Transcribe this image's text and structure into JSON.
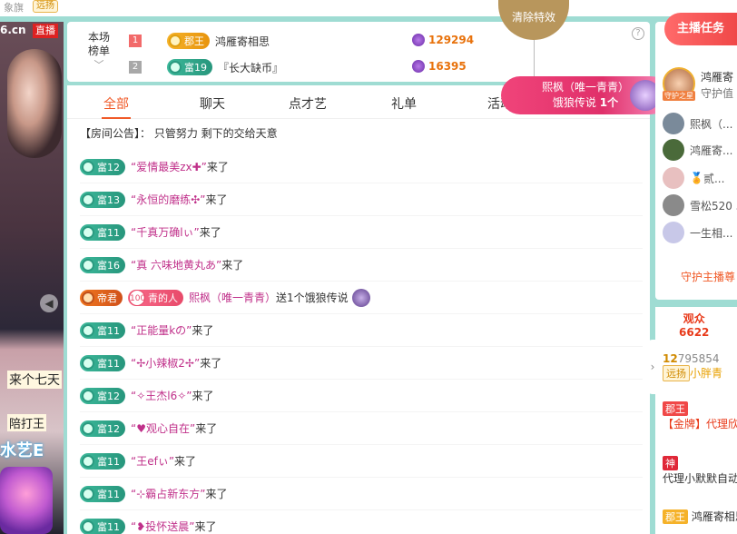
{
  "top_strip": {
    "left_text": "象旗",
    "badge": "远扬"
  },
  "video": {
    "site_text": "6.cn",
    "live_label": "直播",
    "caption1": "来个七天",
    "caption2": "陪打王",
    "banner": "水艺E"
  },
  "ranking": {
    "title": "本场榜单",
    "rows": [
      {
        "rank": "1",
        "badge": "郡王",
        "name": "鸿雁寄相思",
        "score": "129294"
      },
      {
        "rank": "2",
        "badge": "富19",
        "name": "『长大缺币』",
        "score": "16395"
      }
    ],
    "help": "?"
  },
  "clear_effects": {
    "label": "清除特效",
    "close": "✕"
  },
  "gift_banner": {
    "line1": "熙枫（唯一青青）",
    "line2_prefix": "饿狼传说",
    "line2_count": "1个"
  },
  "tabs": [
    "全部",
    "聊天",
    "点才艺",
    "礼单",
    "活动"
  ],
  "notice": "【房间公告】：  只管努力 剩下的交给天意",
  "messages": [
    {
      "badge": "富12",
      "name": "“爱情最美zx✚”",
      "text": "来了"
    },
    {
      "badge": "富13",
      "name": "“永恒的磨练✣”",
      "text": "来了"
    },
    {
      "badge": "富11",
      "name": "“千真万确lぃ”",
      "text": "来了"
    },
    {
      "badge": "富16",
      "name": "“真 六味地黄丸あ”",
      "text": "来了"
    },
    {
      "badge": "帝君",
      "level": "100",
      "badge2": "青的人",
      "name": "熙枫（唯一青青）",
      "text": " 送1个饿狼传说",
      "gift": true
    },
    {
      "badge": "富11",
      "name": "“正能量kの”",
      "text": "来了"
    },
    {
      "badge": "富11",
      "name": "“✢小辣椒2✢”",
      "text": "来了"
    },
    {
      "badge": "富12",
      "name": "“✧王杰l6✧”",
      "text": "来了"
    },
    {
      "badge": "富12",
      "name": "“♥观心自在”",
      "text": "来了"
    },
    {
      "badge": "富11",
      "name": "“王efぃ”",
      "text": "来了"
    },
    {
      "badge": "富11",
      "name": "“⊹霸占新东方”",
      "text": "来了"
    },
    {
      "badge": "富11",
      "name": "“❥投怀送晨”",
      "text": "来了"
    }
  ],
  "guard": {
    "button": "主播任务",
    "top_name": "鸿雁寄",
    "top_sub": "守护值",
    "top_label": "守护之星",
    "items": [
      "熙枫（...",
      "鸿雁寄...",
      "贰...",
      "雪松520 5",
      "一生相..."
    ],
    "link": "守护主播尊"
  },
  "audience": {
    "label": "观众",
    "count": "6622",
    "rows": [
      {
        "a": "12",
        "b": "795854",
        "c": "远扬",
        "d": "小胖青"
      },
      {
        "a": "郡王",
        "b": "【金牌】代理欣"
      },
      {
        "a": "神",
        "b": "代理小默默自动"
      },
      {
        "a": "郡王",
        "b": "鸿雁寄相思"
      }
    ]
  },
  "colors": {
    "accent": "#f05a28",
    "teal_bg": "#9fdcd3",
    "rich_badge": "#3cb89a",
    "gold_badge": "#f5b22a",
    "pink_banner": "#f0447a"
  }
}
